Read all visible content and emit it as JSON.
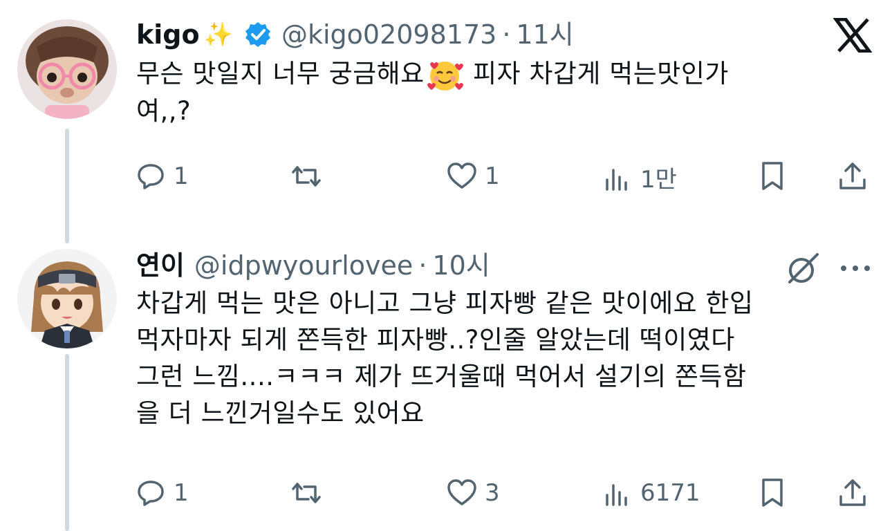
{
  "app": {
    "logo": "x-logo-icon"
  },
  "tweets": [
    {
      "name": "kigo",
      "name_emoji": "✨",
      "verified": true,
      "handle": "@kigo02098173",
      "separator": "·",
      "time": "11시",
      "text_a": "무슨 맛일지 너무 궁금해요",
      "text_b": " 피자 차갑게 먹는맛인가\n여,,?",
      "actions": {
        "reply": "1",
        "retweet": "",
        "like": "1",
        "views": "1만"
      }
    },
    {
      "name": "연이",
      "handle": "@idpwyourlovee",
      "separator": "·",
      "time": "10시",
      "text": "차갑게 먹는 맛은 아니고 그냥 피자빵 같은 맛이에요 한입\n먹자마자 되게 쫀득한 피자빵..?인줄 알았는데 떡이였다\n그런 느낌....ㅋㅋㅋ 제가 뜨거울때 먹어서 설기의 쫀득함\n을 더 느낀거일수도 있어요",
      "actions": {
        "reply": "1",
        "retweet": "",
        "like": "3",
        "views": "6171"
      }
    }
  ],
  "colors": {
    "text": "#0f1419",
    "muted": "#536471",
    "verified": "#1d9bf0",
    "thread": "#cfd9de"
  }
}
